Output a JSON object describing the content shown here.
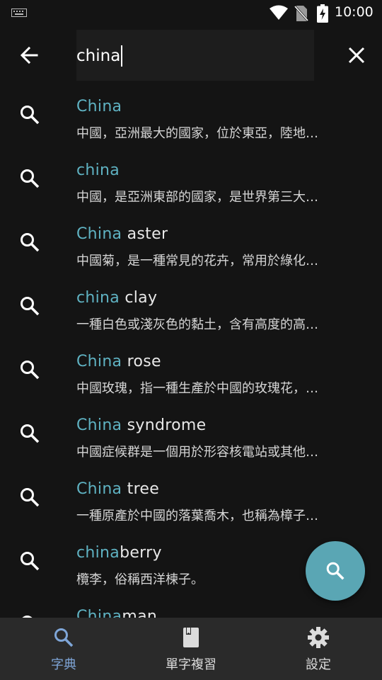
{
  "status": {
    "time": "10:00",
    "icons": [
      "keyboard-icon",
      "wifi-icon",
      "no-sim-icon",
      "battery-charging-icon"
    ]
  },
  "search": {
    "value": "china",
    "back_icon": "arrow-back-icon",
    "clear_icon": "close-icon"
  },
  "results": [
    {
      "highlight": "China",
      "rest": "",
      "definition": "中國，亞洲最大的國家，位於東亞，陸地…"
    },
    {
      "highlight": "china",
      "rest": "",
      "definition": "中國，是亞洲東部的國家，是世界第三大…"
    },
    {
      "highlight": "China",
      "rest": " aster",
      "definition": "中國菊，是一種常見的花卉，常用於綠化…"
    },
    {
      "highlight": "china",
      "rest": " clay",
      "definition": "一種白色或淺灰色的黏土，含有高度的高…"
    },
    {
      "highlight": "China",
      "rest": " rose",
      "definition": "中國玫瑰，指一種生產於中國的玫瑰花，…"
    },
    {
      "highlight": "China",
      "rest": " syndrome",
      "definition": "中國症候群是一個用於形容核電站或其他…"
    },
    {
      "highlight": "China",
      "rest": " tree",
      "definition": "一種原產於中國的落葉喬木，也稱為樟子…"
    },
    {
      "highlight": "china",
      "rest": "berry",
      "definition": "欖李，俗稱西洋楝子。"
    },
    {
      "highlight": "China",
      "rest": "man",
      "definition": ""
    }
  ],
  "fab": {
    "icon": "search-icon"
  },
  "nav": [
    {
      "label": "字典",
      "icon": "search-icon",
      "active": true
    },
    {
      "label": "單字複習",
      "icon": "book-icon",
      "active": false
    },
    {
      "label": "設定",
      "icon": "gear-icon",
      "active": false
    }
  ],
  "colors": {
    "accent": "#5fb2c2",
    "fab": "#5aa6b4",
    "nav_active": "#7fa6d8",
    "background": "#141414"
  }
}
